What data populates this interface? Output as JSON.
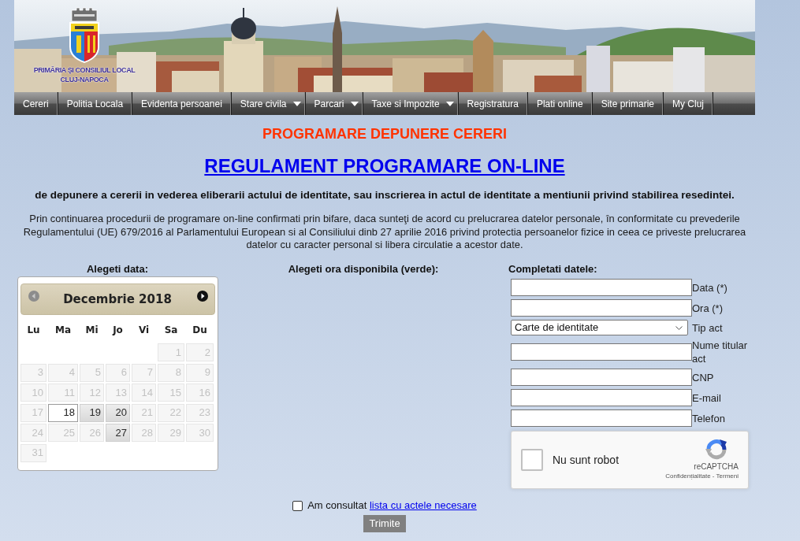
{
  "header": {
    "logo_lines": [
      "PRIMĂRIA ŞI CONSILIUL LOCAL",
      "CLUJ-NAPOCA"
    ]
  },
  "nav": [
    {
      "label": "Cereri",
      "has_submenu": false
    },
    {
      "label": "Politia Locala",
      "has_submenu": false
    },
    {
      "label": "Evidenta persoanei",
      "has_submenu": false
    },
    {
      "label": "Stare civila",
      "has_submenu": true
    },
    {
      "label": "Parcari",
      "has_submenu": true
    },
    {
      "label": "Taxe si Impozite",
      "has_submenu": true
    },
    {
      "label": "Registratura",
      "has_submenu": false
    },
    {
      "label": "Plati online",
      "has_submenu": false
    },
    {
      "label": "Site primarie",
      "has_submenu": false
    },
    {
      "label": "My Cluj",
      "has_submenu": false
    }
  ],
  "page_title": "PROGRAMARE DEPUNERE CERERI",
  "rules_link": "REGULAMENT PROGRAMARE ON-LINE",
  "subtitle": "de depunere a cererii in vederea eliberarii actului de identitate, sau inscrierea in actul de identitate a mentiunii privind stabilirea resedintei.",
  "consent_text": "Prin continuarea procedurii de programare on-line confirmati prin bifare, daca sunteţi de acord cu prelucrarea datelor personale, în conformitate cu prevederile Regulamentului (UE) 679/2016 al Parlamentului European si al Consiliului dinb 27 aprilie 2016 privind protectia persoanelor fizice in ceea ce priveste prelucrarea datelor cu caracter personal si libera circulatie a acestor date.",
  "date_column": {
    "heading": "Alegeti data:",
    "calendar": {
      "month_title": "Decembrie 2018",
      "prev_disabled": true,
      "next_disabled": false,
      "weekdays": [
        "Lu",
        "Ma",
        "Mi",
        "Jo",
        "Vi",
        "Sa",
        "Du"
      ],
      "weeks": [
        [
          {
            "kind": "empty"
          },
          {
            "kind": "empty"
          },
          {
            "kind": "empty"
          },
          {
            "kind": "empty"
          },
          {
            "kind": "empty"
          },
          {
            "kind": "day",
            "day": "1",
            "disabled": true,
            "selected": false
          },
          {
            "kind": "day",
            "day": "2",
            "disabled": true,
            "selected": false
          }
        ],
        [
          {
            "kind": "day",
            "day": "3",
            "disabled": true,
            "selected": false
          },
          {
            "kind": "day",
            "day": "4",
            "disabled": true,
            "selected": false
          },
          {
            "kind": "day",
            "day": "5",
            "disabled": true,
            "selected": false
          },
          {
            "kind": "day",
            "day": "6",
            "disabled": true,
            "selected": false
          },
          {
            "kind": "day",
            "day": "7",
            "disabled": true,
            "selected": false
          },
          {
            "kind": "day",
            "day": "8",
            "disabled": true,
            "selected": false
          },
          {
            "kind": "day",
            "day": "9",
            "disabled": true,
            "selected": false
          }
        ],
        [
          {
            "kind": "day",
            "day": "10",
            "disabled": true,
            "selected": false
          },
          {
            "kind": "day",
            "day": "11",
            "disabled": true,
            "selected": false
          },
          {
            "kind": "day",
            "day": "12",
            "disabled": true,
            "selected": false
          },
          {
            "kind": "day",
            "day": "13",
            "disabled": true,
            "selected": false
          },
          {
            "kind": "day",
            "day": "14",
            "disabled": true,
            "selected": false
          },
          {
            "kind": "day",
            "day": "15",
            "disabled": true,
            "selected": false
          },
          {
            "kind": "day",
            "day": "16",
            "disabled": true,
            "selected": false
          }
        ],
        [
          {
            "kind": "day",
            "day": "17",
            "disabled": true,
            "selected": false
          },
          {
            "kind": "day",
            "day": "18",
            "disabled": false,
            "selected": true
          },
          {
            "kind": "day",
            "day": "19",
            "disabled": false,
            "selected": false
          },
          {
            "kind": "day",
            "day": "20",
            "disabled": false,
            "selected": false
          },
          {
            "kind": "day",
            "day": "21",
            "disabled": true,
            "selected": false
          },
          {
            "kind": "day",
            "day": "22",
            "disabled": true,
            "selected": false
          },
          {
            "kind": "day",
            "day": "23",
            "disabled": true,
            "selected": false
          }
        ],
        [
          {
            "kind": "day",
            "day": "24",
            "disabled": true,
            "selected": false
          },
          {
            "kind": "day",
            "day": "25",
            "disabled": true,
            "selected": false
          },
          {
            "kind": "day",
            "day": "26",
            "disabled": true,
            "selected": false
          },
          {
            "kind": "day",
            "day": "27",
            "disabled": false,
            "selected": false
          },
          {
            "kind": "day",
            "day": "28",
            "disabled": true,
            "selected": false
          },
          {
            "kind": "day",
            "day": "29",
            "disabled": true,
            "selected": false
          },
          {
            "kind": "day",
            "day": "30",
            "disabled": true,
            "selected": false
          }
        ],
        [
          {
            "kind": "day",
            "day": "31",
            "disabled": true,
            "selected": false
          }
        ]
      ]
    }
  },
  "time_column": {
    "heading": "Alegeti ora disponibila (verde):"
  },
  "form": {
    "heading": "Completati datele:",
    "fields": [
      {
        "kind": "text",
        "label": "Data (*)"
      },
      {
        "kind": "text",
        "label": "Ora (*)"
      },
      {
        "kind": "select",
        "label": "Tip act",
        "value": "Carte de identitate"
      },
      {
        "kind": "text",
        "label": "Nume titular act"
      },
      {
        "kind": "text",
        "label": "CNP"
      },
      {
        "kind": "text",
        "label": "E-mail"
      },
      {
        "kind": "text",
        "label": "Telefon"
      }
    ]
  },
  "captcha": {
    "checked": false,
    "label": "Nu sunt robot",
    "brand": "reCAPTCHA",
    "legal_links": "Confidențialitate - Termeni"
  },
  "agreement": {
    "checked": false,
    "text": "Am consultat",
    "link": "lista cu actele necesare"
  },
  "submit": "Trimite"
}
